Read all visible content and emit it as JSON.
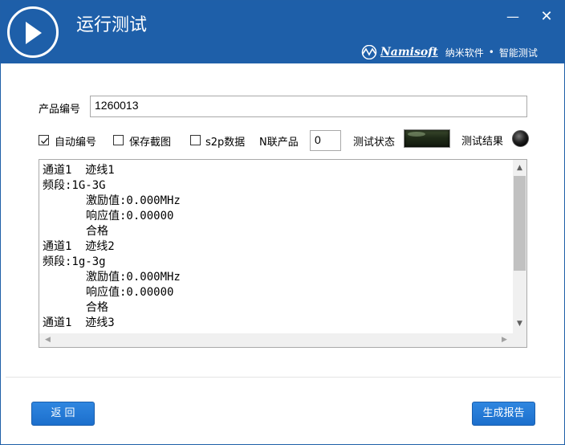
{
  "window": {
    "title": "运行测试",
    "minimize_glyph": "—",
    "close_glyph": "✕"
  },
  "brand": {
    "name": "Namisoft",
    "company": "纳米软件",
    "separator": "•",
    "product": "智能测试"
  },
  "form": {
    "product_code_label": "产品编号",
    "product_code_value": "1260013",
    "auto_number_label": "自动编号",
    "auto_number_checked": true,
    "save_screenshot_label": "保存截图",
    "save_screenshot_checked": false,
    "s2p_label": "s2p数据",
    "s2p_checked": false,
    "n_products_label": "N联产品",
    "n_products_value": "0",
    "test_status_label": "测试状态",
    "test_result_label": "测试结果"
  },
  "log": {
    "lines": [
      {
        "text": "通道1  迹线1",
        "indent": false
      },
      {
        "text": "频段:1G-3G",
        "indent": false
      },
      {
        "text": "激励值:0.000MHz",
        "indent": true
      },
      {
        "text": "响应值:0.00000",
        "indent": true
      },
      {
        "text": "合格",
        "indent": true
      },
      {
        "text": "通道1  迹线2",
        "indent": false
      },
      {
        "text": "频段:1g-3g",
        "indent": false
      },
      {
        "text": "激励值:0.000MHz",
        "indent": true
      },
      {
        "text": "响应值:0.00000",
        "indent": true
      },
      {
        "text": "合格",
        "indent": true
      },
      {
        "text": "通道1  迹线3",
        "indent": false
      }
    ]
  },
  "buttons": {
    "back_label": "返  回",
    "report_label": "生成报告"
  },
  "colors": {
    "titlebar": "#1e5fa9",
    "button": "#2479d6"
  }
}
